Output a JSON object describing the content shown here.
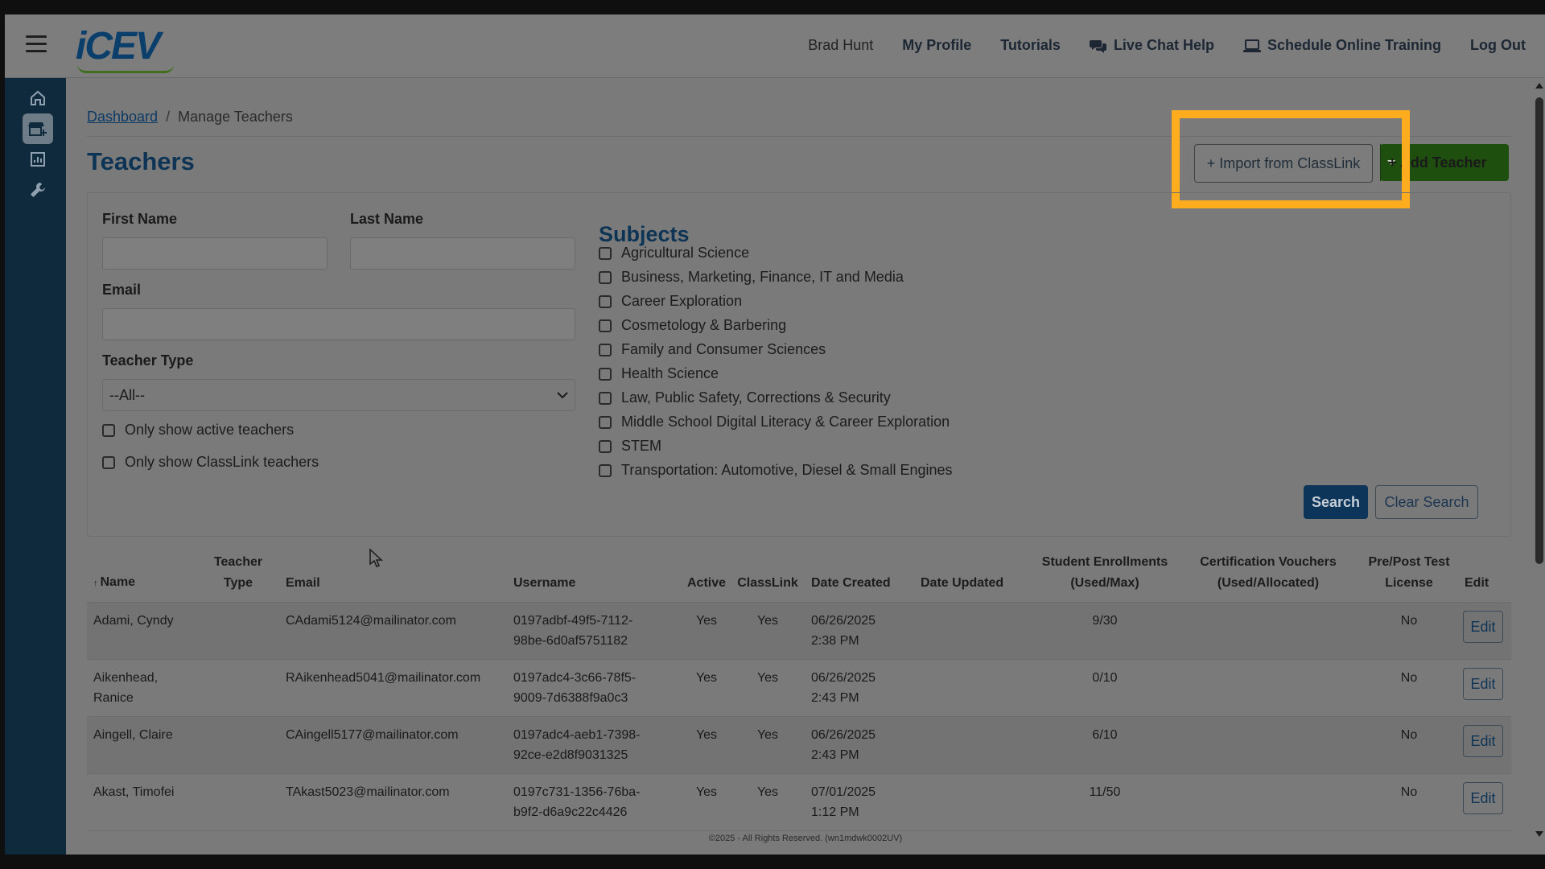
{
  "header": {
    "logo": "iCEV",
    "user_name": "Brad Hunt",
    "nav": {
      "my_profile": "My Profile",
      "tutorials": "Tutorials",
      "live_chat": "Live Chat Help",
      "schedule_training": "Schedule Online Training",
      "log_out": "Log Out"
    }
  },
  "sidebar": {
    "icons": [
      "home-icon",
      "store-add-icon",
      "report-chart-icon",
      "wrench-icon"
    ],
    "active_index": 1
  },
  "breadcrumb": {
    "root": "Dashboard",
    "separator": "/",
    "current": "Manage Teachers"
  },
  "page": {
    "title": "Teachers",
    "import_button": "+ Import from ClassLink",
    "add_button": "+ Add Teacher"
  },
  "filters": {
    "first_name_label": "First Name",
    "first_name_value": "",
    "last_name_label": "Last Name",
    "last_name_value": "",
    "email_label": "Email",
    "email_value": "",
    "teacher_type_label": "Teacher Type",
    "teacher_type_value": "--All--",
    "active_only_label": "Only show active teachers",
    "classlink_only_label": "Only show ClassLink teachers",
    "subjects_title": "Subjects",
    "subjects": [
      "Agricultural Science",
      "Business, Marketing, Finance, IT and Media",
      "Career Exploration",
      "Cosmetology & Barbering",
      "Family and Consumer Sciences",
      "Health Science",
      "Law, Public Safety, Corrections & Security",
      "Middle School Digital Literacy & Career Exploration",
      "STEM",
      "Transportation: Automotive, Diesel & Small Engines"
    ],
    "search_button": "Search",
    "clear_button": "Clear Search"
  },
  "table": {
    "headers": {
      "name": "Name",
      "teacher_type_1": "Teacher",
      "teacher_type_2": "Type",
      "email": "Email",
      "username": "Username",
      "active": "Active",
      "classlink": "ClassLink",
      "date_created": "Date Created",
      "date_updated": "Date Updated",
      "enrollments_1": "Student Enrollments",
      "enrollments_2": "(Used/Max)",
      "vouchers_1": "Certification Vouchers",
      "vouchers_2": "(Used/Allocated)",
      "prepost_1": "Pre/Post Test",
      "prepost_2": "License",
      "edit": "Edit"
    },
    "sort_indicator": "↑",
    "rows": [
      {
        "name_1": "Adami, Cyndy",
        "name_2": "",
        "email": "CAdami5124@mailinator.com",
        "user_1": "0197adbf-49f5-7112-",
        "user_2": "98be-6d0af5751182",
        "active": "Yes",
        "classlink": "Yes",
        "created_1": "06/26/2025",
        "created_2": "2:38 PM",
        "enroll": "9/30",
        "license": "No",
        "edit": "Edit"
      },
      {
        "name_1": "Aikenhead,",
        "name_2": "Ranice",
        "email": "RAikenhead5041@mailinator.com",
        "user_1": "0197adc4-3c66-78f5-",
        "user_2": "9009-7d6388f9a0c3",
        "active": "Yes",
        "classlink": "Yes",
        "created_1": "06/26/2025",
        "created_2": "2:43 PM",
        "enroll": "0/10",
        "license": "No",
        "edit": "Edit"
      },
      {
        "name_1": "Aingell, Claire",
        "name_2": "",
        "email": "CAingell5177@mailinator.com",
        "user_1": "0197adc4-aeb1-7398-",
        "user_2": "92ce-e2d8f9031325",
        "active": "Yes",
        "classlink": "Yes",
        "created_1": "06/26/2025",
        "created_2": "2:43 PM",
        "enroll": "6/10",
        "license": "No",
        "edit": "Edit"
      },
      {
        "name_1": "Akast, Timofei",
        "name_2": "",
        "email": "TAkast5023@mailinator.com",
        "user_1": "0197c731-1356-76ba-",
        "user_2": "b9f2-d6a9c22c4426",
        "active": "Yes",
        "classlink": "Yes",
        "created_1": "07/01/2025",
        "created_2": "1:12 PM",
        "enroll": "11/50",
        "license": "No",
        "edit": "Edit"
      }
    ]
  },
  "footer": "©2025 - All Rights Reserved. (wn1mdwk0002UV)",
  "colors": {
    "brand_navy": "#0d3454",
    "add_green": "#1f4f0f",
    "highlight": "#ffad1f"
  }
}
